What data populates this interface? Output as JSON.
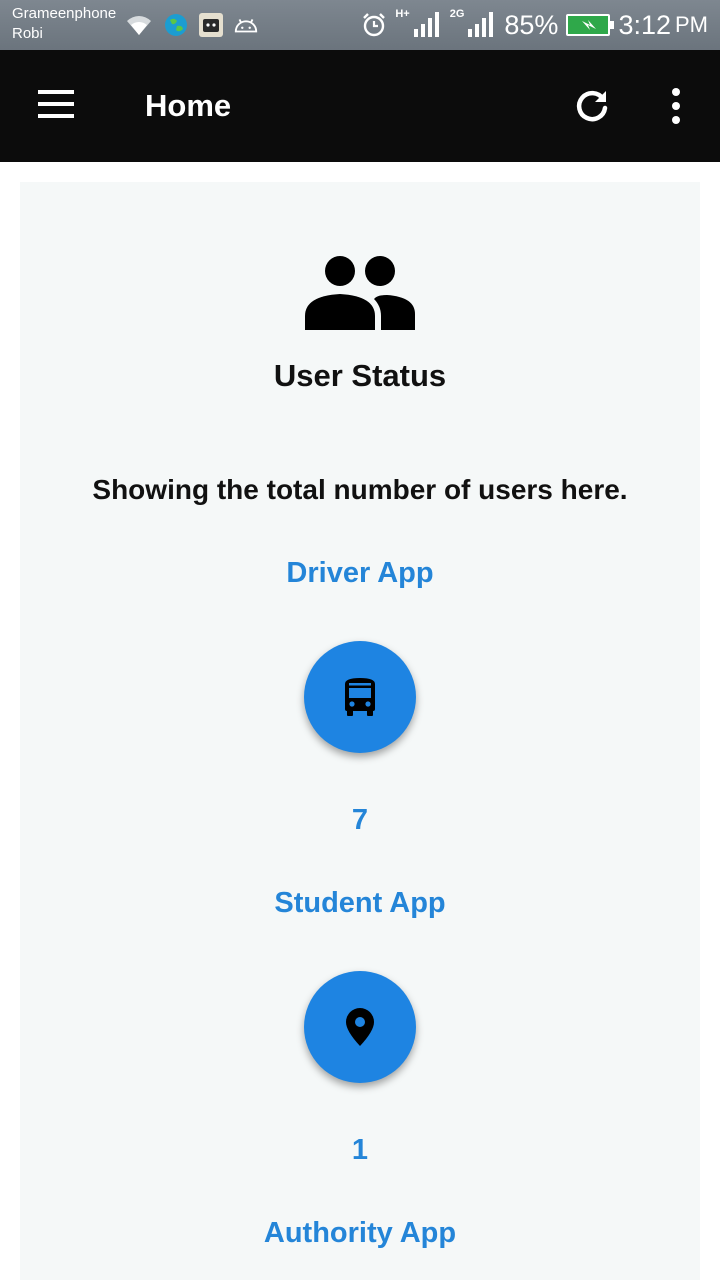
{
  "status_bar": {
    "carrier_1": "Grameenphone",
    "carrier_2": "Robi",
    "network_1": "H+",
    "network_2": "2G",
    "battery": "85%",
    "time": "3:12",
    "ampm": "PM",
    "icons": [
      "wifi-icon",
      "globe-app-icon",
      "cat-app-icon",
      "android-icon",
      "alarm-icon",
      "signal-icon",
      "battery-charging-icon"
    ]
  },
  "app_bar": {
    "title": "Home",
    "icons": [
      "menu-icon",
      "refresh-icon",
      "more-vert-icon"
    ],
    "background": "#0c0c0c"
  },
  "main": {
    "header_icon": "group-icon",
    "title": "User Status",
    "description": "Showing the total number of users here.",
    "sections": [
      {
        "label": "Driver App",
        "icon": "bus-icon",
        "count": "7"
      },
      {
        "label": "Student App",
        "icon": "location-pin-icon",
        "count": "1"
      },
      {
        "label": "Authority App"
      }
    ]
  },
  "colors": {
    "accent": "#2485d8",
    "fab": "#1e84e2",
    "card_background": "#f5f8f8"
  }
}
